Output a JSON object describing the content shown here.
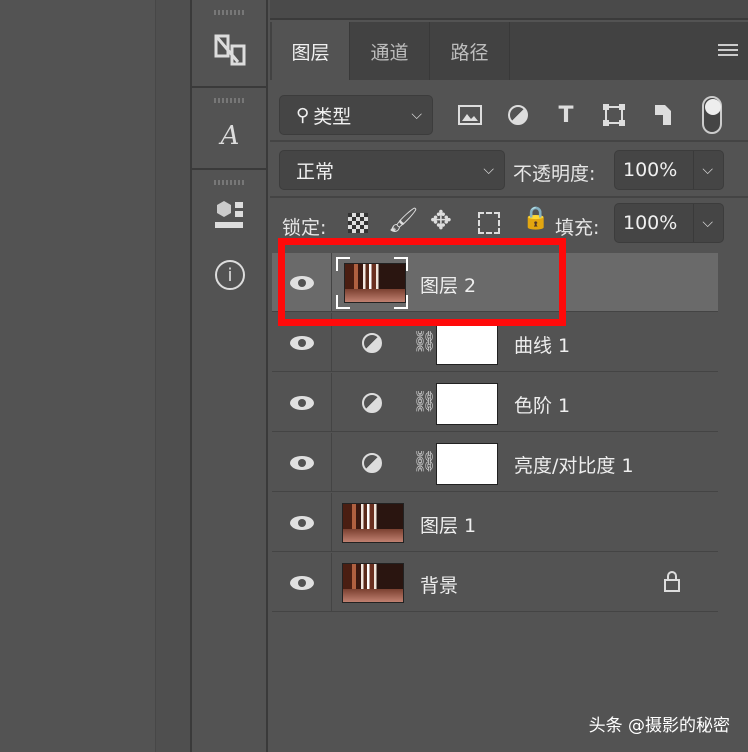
{
  "tabs": [
    {
      "label": "图层"
    },
    {
      "label": "通道"
    },
    {
      "label": "路径"
    }
  ],
  "filter": {
    "label": "类型"
  },
  "blend": {
    "mode": "正常",
    "opacity_label": "不透明度:",
    "opacity": "100%"
  },
  "lock": {
    "label": "锁定:",
    "fill_label": "填充:",
    "fill": "100%"
  },
  "layers": [
    {
      "name": "图层 2",
      "selected": true
    },
    {
      "name": "曲线 1"
    },
    {
      "name": "色阶 1"
    },
    {
      "name": "亮度/对比度 1"
    },
    {
      "name": "图层 1"
    },
    {
      "name": "背景",
      "locked": true
    }
  ],
  "toolbar": {
    "icons": [
      "3d-transform-icon",
      "glyphs-icon",
      "properties-icon",
      "info-icon"
    ],
    "glyph_a": "A",
    "info": "i"
  },
  "watermark": "头条 @摄影的秘密",
  "colors": {
    "highlight": "#ff0a0a",
    "panel": "#535353"
  }
}
